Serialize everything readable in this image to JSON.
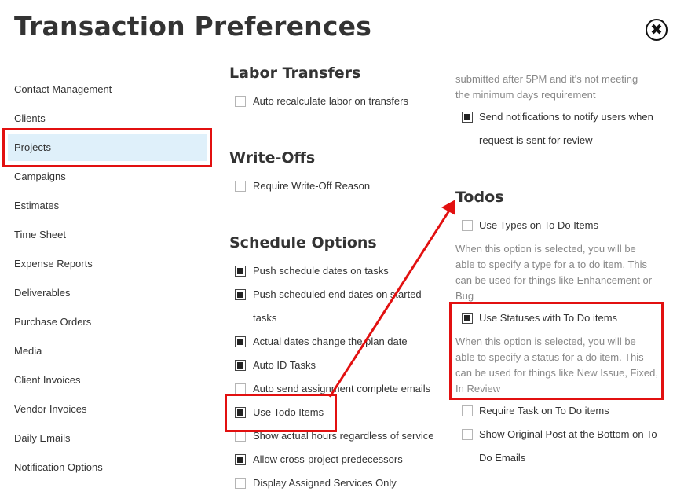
{
  "header": {
    "title": "Transaction Preferences",
    "close_icon": "close-circle-icon"
  },
  "sidebar": {
    "items": [
      {
        "label": "Contact Management"
      },
      {
        "label": "Clients"
      },
      {
        "label": "Projects",
        "active": true
      },
      {
        "label": "Campaigns"
      },
      {
        "label": "Estimates"
      },
      {
        "label": "Time Sheet"
      },
      {
        "label": "Expense Reports"
      },
      {
        "label": "Deliverables"
      },
      {
        "label": "Purchase Orders"
      },
      {
        "label": "Media"
      },
      {
        "label": "Client Invoices"
      },
      {
        "label": "Vendor Invoices"
      },
      {
        "label": "Daily Emails"
      },
      {
        "label": "Notification Options"
      }
    ]
  },
  "labor_transfers": {
    "title": "Labor Transfers",
    "options": [
      {
        "label": "Auto recalculate labor on transfers",
        "checked": false
      }
    ]
  },
  "write_offs": {
    "title": "Write-Offs",
    "options": [
      {
        "label": "Require Write-Off Reason",
        "checked": false
      }
    ]
  },
  "schedule_options": {
    "title": "Schedule Options",
    "options": [
      {
        "label": "Push schedule dates on tasks",
        "checked": true
      },
      {
        "label": "Push scheduled end dates on started",
        "label2": "tasks",
        "checked": true
      },
      {
        "label": "Actual dates change the plan date",
        "checked": true
      },
      {
        "label": "Auto ID Tasks",
        "checked": true
      },
      {
        "label": "Auto send assignment complete emails",
        "checked": false
      },
      {
        "label": "Use Todo Items",
        "checked": true
      },
      {
        "label": "Show actual hours regardless of service",
        "checked": false
      },
      {
        "label": "Allow cross-project predecessors",
        "checked": true
      },
      {
        "label": "Display Assigned Services Only",
        "checked": false
      }
    ]
  },
  "right_top": {
    "desc_lines": [
      "submitted after 5PM and it's not meeting",
      "the minimum days requirement"
    ],
    "option": {
      "label": "Send notifications to notify users when",
      "label2": "request is sent for review",
      "checked": true
    }
  },
  "todos": {
    "title": "Todos",
    "options": [
      {
        "label": "Use Types on To Do Items",
        "checked": false,
        "desc": [
          "When this option is selected, you will be",
          "able to specify a type for a to do item. This",
          "can be used for things like Enhancement or",
          "Bug"
        ]
      },
      {
        "label": "Use Statuses with To Do items",
        "checked": true,
        "desc": [
          "When this option is selected, you will be",
          "able to specify a status for a do item. This",
          "can be used for things like New Issue, Fixed,",
          "In Review"
        ]
      },
      {
        "label": "Require Task on To Do items",
        "checked": false
      },
      {
        "label": "Show Original Post at the Bottom on To",
        "label2": "Do Emails",
        "checked": false
      }
    ]
  },
  "annotation_color": "#e21010"
}
